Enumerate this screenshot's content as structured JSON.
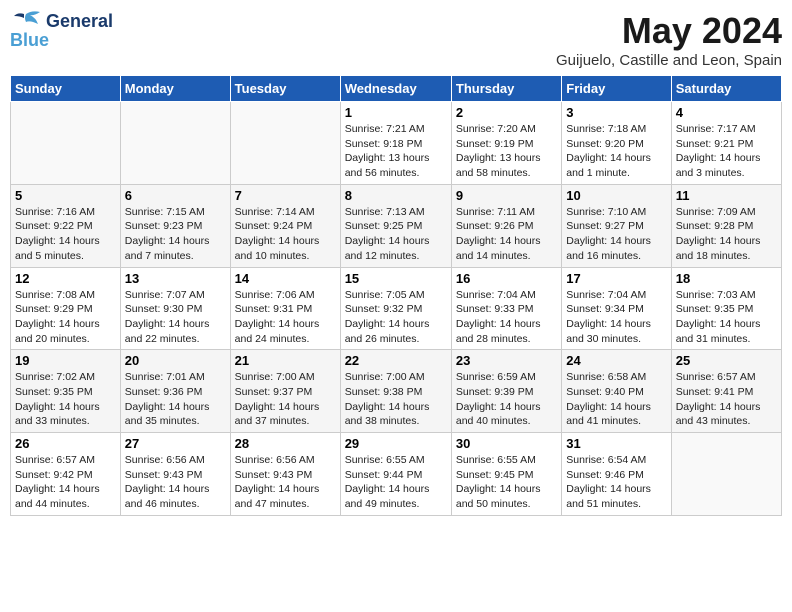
{
  "logo": {
    "line1": "General",
    "line2": "Blue",
    "bird": "🐦"
  },
  "title": "May 2024",
  "location": "Guijuelo, Castille and Leon, Spain",
  "days_header": [
    "Sunday",
    "Monday",
    "Tuesday",
    "Wednesday",
    "Thursday",
    "Friday",
    "Saturday"
  ],
  "weeks": [
    [
      {
        "day": "",
        "sunrise": "",
        "sunset": "",
        "daylight": "",
        "empty": true
      },
      {
        "day": "",
        "sunrise": "",
        "sunset": "",
        "daylight": "",
        "empty": true
      },
      {
        "day": "",
        "sunrise": "",
        "sunset": "",
        "daylight": "",
        "empty": true
      },
      {
        "day": "1",
        "sunrise": "Sunrise: 7:21 AM",
        "sunset": "Sunset: 9:18 PM",
        "daylight": "Daylight: 13 hours and 56 minutes."
      },
      {
        "day": "2",
        "sunrise": "Sunrise: 7:20 AM",
        "sunset": "Sunset: 9:19 PM",
        "daylight": "Daylight: 13 hours and 58 minutes."
      },
      {
        "day": "3",
        "sunrise": "Sunrise: 7:18 AM",
        "sunset": "Sunset: 9:20 PM",
        "daylight": "Daylight: 14 hours and 1 minute."
      },
      {
        "day": "4",
        "sunrise": "Sunrise: 7:17 AM",
        "sunset": "Sunset: 9:21 PM",
        "daylight": "Daylight: 14 hours and 3 minutes."
      }
    ],
    [
      {
        "day": "5",
        "sunrise": "Sunrise: 7:16 AM",
        "sunset": "Sunset: 9:22 PM",
        "daylight": "Daylight: 14 hours and 5 minutes."
      },
      {
        "day": "6",
        "sunrise": "Sunrise: 7:15 AM",
        "sunset": "Sunset: 9:23 PM",
        "daylight": "Daylight: 14 hours and 7 minutes."
      },
      {
        "day": "7",
        "sunrise": "Sunrise: 7:14 AM",
        "sunset": "Sunset: 9:24 PM",
        "daylight": "Daylight: 14 hours and 10 minutes."
      },
      {
        "day": "8",
        "sunrise": "Sunrise: 7:13 AM",
        "sunset": "Sunset: 9:25 PM",
        "daylight": "Daylight: 14 hours and 12 minutes."
      },
      {
        "day": "9",
        "sunrise": "Sunrise: 7:11 AM",
        "sunset": "Sunset: 9:26 PM",
        "daylight": "Daylight: 14 hours and 14 minutes."
      },
      {
        "day": "10",
        "sunrise": "Sunrise: 7:10 AM",
        "sunset": "Sunset: 9:27 PM",
        "daylight": "Daylight: 14 hours and 16 minutes."
      },
      {
        "day": "11",
        "sunrise": "Sunrise: 7:09 AM",
        "sunset": "Sunset: 9:28 PM",
        "daylight": "Daylight: 14 hours and 18 minutes."
      }
    ],
    [
      {
        "day": "12",
        "sunrise": "Sunrise: 7:08 AM",
        "sunset": "Sunset: 9:29 PM",
        "daylight": "Daylight: 14 hours and 20 minutes."
      },
      {
        "day": "13",
        "sunrise": "Sunrise: 7:07 AM",
        "sunset": "Sunset: 9:30 PM",
        "daylight": "Daylight: 14 hours and 22 minutes."
      },
      {
        "day": "14",
        "sunrise": "Sunrise: 7:06 AM",
        "sunset": "Sunset: 9:31 PM",
        "daylight": "Daylight: 14 hours and 24 minutes."
      },
      {
        "day": "15",
        "sunrise": "Sunrise: 7:05 AM",
        "sunset": "Sunset: 9:32 PM",
        "daylight": "Daylight: 14 hours and 26 minutes."
      },
      {
        "day": "16",
        "sunrise": "Sunrise: 7:04 AM",
        "sunset": "Sunset: 9:33 PM",
        "daylight": "Daylight: 14 hours and 28 minutes."
      },
      {
        "day": "17",
        "sunrise": "Sunrise: 7:04 AM",
        "sunset": "Sunset: 9:34 PM",
        "daylight": "Daylight: 14 hours and 30 minutes."
      },
      {
        "day": "18",
        "sunrise": "Sunrise: 7:03 AM",
        "sunset": "Sunset: 9:35 PM",
        "daylight": "Daylight: 14 hours and 31 minutes."
      }
    ],
    [
      {
        "day": "19",
        "sunrise": "Sunrise: 7:02 AM",
        "sunset": "Sunset: 9:35 PM",
        "daylight": "Daylight: 14 hours and 33 minutes."
      },
      {
        "day": "20",
        "sunrise": "Sunrise: 7:01 AM",
        "sunset": "Sunset: 9:36 PM",
        "daylight": "Daylight: 14 hours and 35 minutes."
      },
      {
        "day": "21",
        "sunrise": "Sunrise: 7:00 AM",
        "sunset": "Sunset: 9:37 PM",
        "daylight": "Daylight: 14 hours and 37 minutes."
      },
      {
        "day": "22",
        "sunrise": "Sunrise: 7:00 AM",
        "sunset": "Sunset: 9:38 PM",
        "daylight": "Daylight: 14 hours and 38 minutes."
      },
      {
        "day": "23",
        "sunrise": "Sunrise: 6:59 AM",
        "sunset": "Sunset: 9:39 PM",
        "daylight": "Daylight: 14 hours and 40 minutes."
      },
      {
        "day": "24",
        "sunrise": "Sunrise: 6:58 AM",
        "sunset": "Sunset: 9:40 PM",
        "daylight": "Daylight: 14 hours and 41 minutes."
      },
      {
        "day": "25",
        "sunrise": "Sunrise: 6:57 AM",
        "sunset": "Sunset: 9:41 PM",
        "daylight": "Daylight: 14 hours and 43 minutes."
      }
    ],
    [
      {
        "day": "26",
        "sunrise": "Sunrise: 6:57 AM",
        "sunset": "Sunset: 9:42 PM",
        "daylight": "Daylight: 14 hours and 44 minutes."
      },
      {
        "day": "27",
        "sunrise": "Sunrise: 6:56 AM",
        "sunset": "Sunset: 9:43 PM",
        "daylight": "Daylight: 14 hours and 46 minutes."
      },
      {
        "day": "28",
        "sunrise": "Sunrise: 6:56 AM",
        "sunset": "Sunset: 9:43 PM",
        "daylight": "Daylight: 14 hours and 47 minutes."
      },
      {
        "day": "29",
        "sunrise": "Sunrise: 6:55 AM",
        "sunset": "Sunset: 9:44 PM",
        "daylight": "Daylight: 14 hours and 49 minutes."
      },
      {
        "day": "30",
        "sunrise": "Sunrise: 6:55 AM",
        "sunset": "Sunset: 9:45 PM",
        "daylight": "Daylight: 14 hours and 50 minutes."
      },
      {
        "day": "31",
        "sunrise": "Sunrise: 6:54 AM",
        "sunset": "Sunset: 9:46 PM",
        "daylight": "Daylight: 14 hours and 51 minutes."
      },
      {
        "day": "",
        "sunrise": "",
        "sunset": "",
        "daylight": "",
        "empty": true
      }
    ]
  ]
}
